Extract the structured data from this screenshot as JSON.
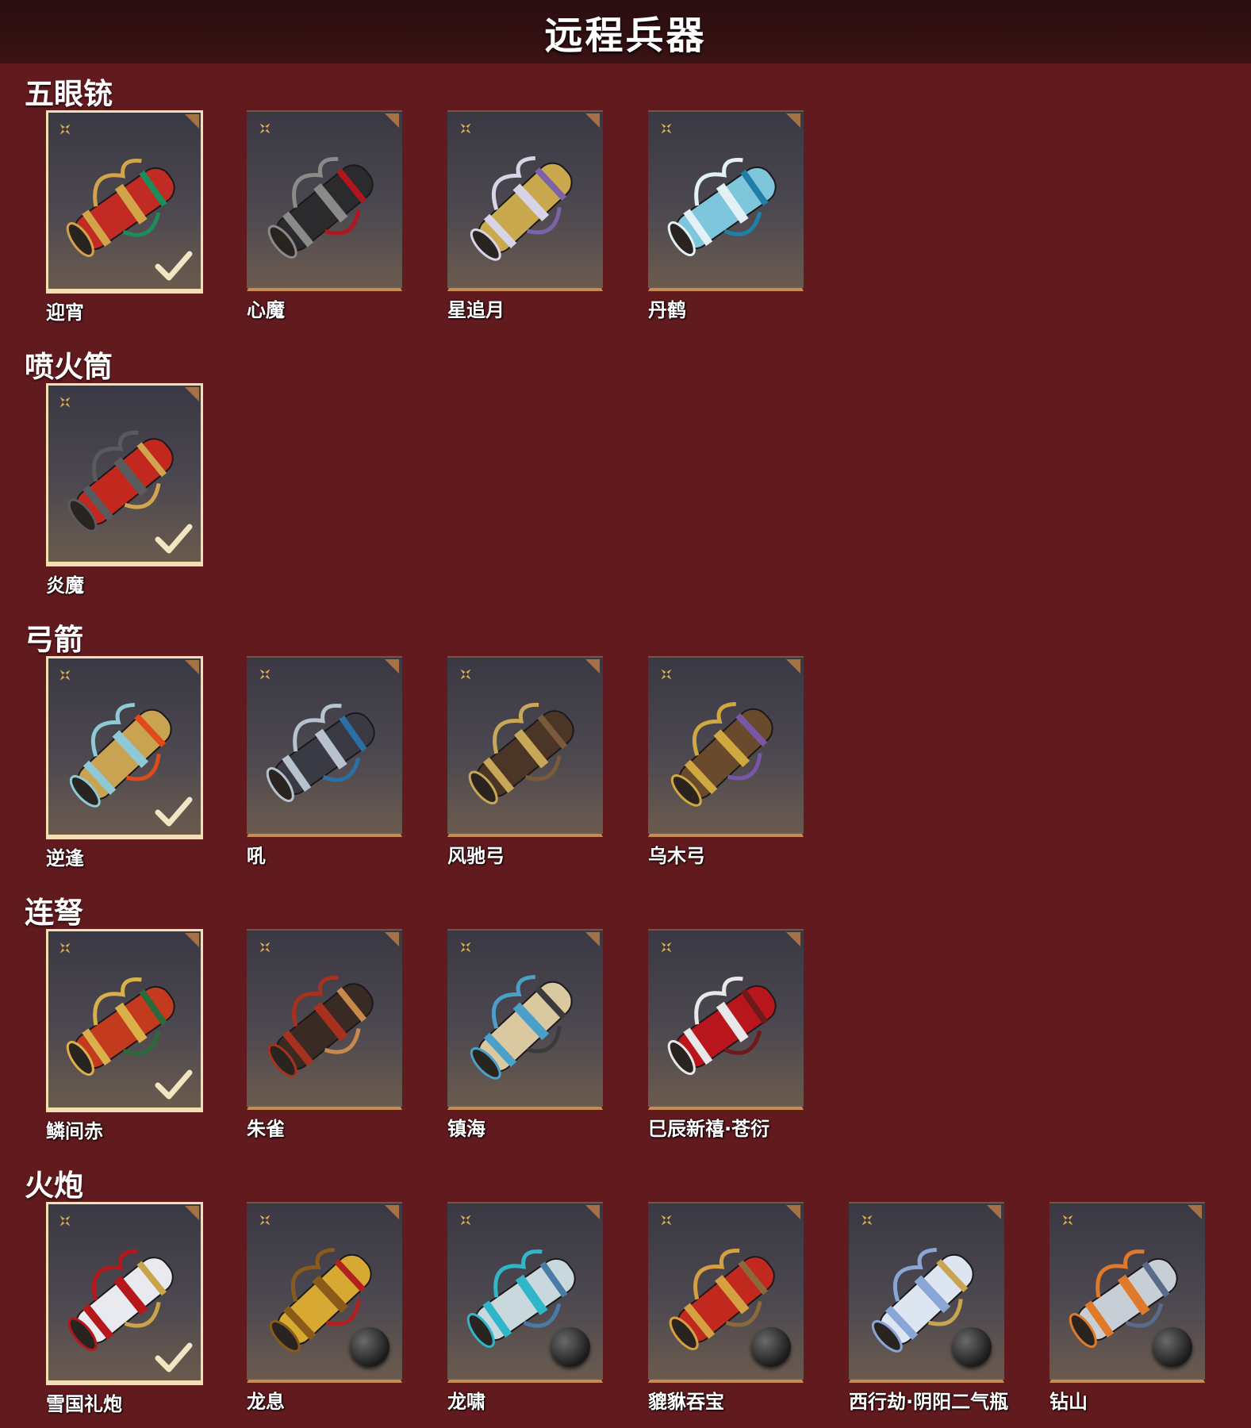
{
  "page_title": "远程兵器",
  "sections": [
    {
      "title": "五眼铳",
      "items": [
        {
          "name": "迎宵",
          "selected": true,
          "has_cannonball": false,
          "colors": [
            "#c12b24",
            "#d2a44a",
            "#1c8c5a"
          ]
        },
        {
          "name": "心魔",
          "selected": false,
          "has_cannonball": false,
          "colors": [
            "#2b2a2d",
            "#8a8a8a",
            "#b0161c"
          ]
        },
        {
          "name": "星追月",
          "selected": false,
          "has_cannonball": false,
          "colors": [
            "#c9a84e",
            "#d8d4e8",
            "#7c62a8"
          ]
        },
        {
          "name": "丹鹤",
          "selected": false,
          "has_cannonball": false,
          "colors": [
            "#7ec6db",
            "#e3f1f4",
            "#1f7fa8"
          ]
        }
      ]
    },
    {
      "title": "喷火筒",
      "items": [
        {
          "name": "炎魔",
          "selected": true,
          "has_cannonball": false,
          "colors": [
            "#c2281e",
            "#5a5a5e",
            "#d1a450"
          ]
        }
      ]
    },
    {
      "title": "弓箭",
      "items": [
        {
          "name": "逆逢",
          "selected": true,
          "has_cannonball": false,
          "colors": [
            "#c9a352",
            "#8fc9d6",
            "#e04a1a"
          ]
        },
        {
          "name": "吼",
          "selected": false,
          "has_cannonball": false,
          "colors": [
            "#3a3a44",
            "#b8c2cf",
            "#2a6fa6"
          ]
        },
        {
          "name": "风驰弓",
          "selected": false,
          "has_cannonball": false,
          "colors": [
            "#4a3526",
            "#c8a758",
            "#7a5a3a"
          ]
        },
        {
          "name": "乌木弓",
          "selected": false,
          "has_cannonball": false,
          "colors": [
            "#6a4a2c",
            "#d0a840",
            "#7a56a8"
          ]
        }
      ]
    },
    {
      "title": "连弩",
      "items": [
        {
          "name": "鳞间赤",
          "selected": true,
          "has_cannonball": false,
          "colors": [
            "#c33a1e",
            "#d9b04a",
            "#2b6a3a"
          ]
        },
        {
          "name": "朱雀",
          "selected": false,
          "has_cannonball": false,
          "colors": [
            "#3a2a24",
            "#a8301e",
            "#c88a4a"
          ]
        },
        {
          "name": "镇海",
          "selected": false,
          "has_cannonball": false,
          "colors": [
            "#d9c8a0",
            "#4aa0c8",
            "#3a3a3a"
          ]
        },
        {
          "name": "巳辰新禧·苍衍",
          "selected": false,
          "has_cannonball": false,
          "colors": [
            "#b8161c",
            "#e8e8e8",
            "#6e1a1a"
          ]
        }
      ]
    },
    {
      "title": "火炮",
      "items": [
        {
          "name": "雪国礼炮",
          "selected": true,
          "has_cannonball": false,
          "colors": [
            "#e8eaf0",
            "#b5171b",
            "#c9a44a"
          ]
        },
        {
          "name": "龙息",
          "selected": false,
          "has_cannonball": true,
          "colors": [
            "#d8a932",
            "#8a5a1a",
            "#b21f1f"
          ]
        },
        {
          "name": "龙啸",
          "selected": false,
          "has_cannonball": true,
          "colors": [
            "#c8d8dc",
            "#2fb6c8",
            "#4a7aa6"
          ]
        },
        {
          "name": "貔貅吞宝",
          "selected": false,
          "has_cannonball": true,
          "colors": [
            "#c1281e",
            "#d5a042",
            "#8a6a3a"
          ]
        },
        {
          "name": "西行劫·阴阳二气瓶",
          "selected": false,
          "has_cannonball": true,
          "colors": [
            "#dde6f0",
            "#8aa6d6",
            "#c9a452"
          ]
        },
        {
          "name": "钻山",
          "selected": false,
          "has_cannonball": true,
          "colors": [
            "#c8ced6",
            "#e07a2a",
            "#5a6a8a"
          ]
        }
      ]
    }
  ]
}
